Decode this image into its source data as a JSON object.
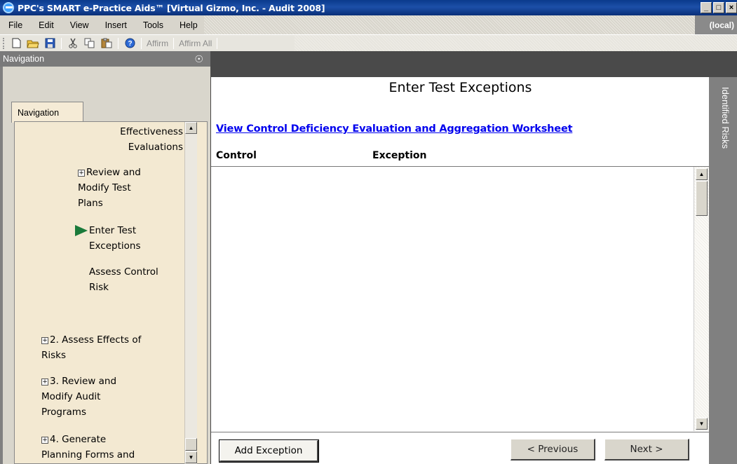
{
  "window": {
    "title": "PPC's SMART e-Practice Aids™ [Virtual Gizmo, Inc. - Audit 2008]",
    "buttons": [
      "_",
      "□",
      "×"
    ]
  },
  "menu": {
    "items": [
      "File",
      "Edit",
      "View",
      "Insert",
      "Tools",
      "Help"
    ],
    "right_label": "(local)"
  },
  "toolbar": {
    "icons": [
      "new-icon",
      "open-icon",
      "save-icon",
      "cut-icon",
      "copy-icon",
      "paste-icon",
      "help-icon"
    ],
    "affirm": "Affirm",
    "affirm_all": "Affirm All"
  },
  "navigation": {
    "header": "Navigation",
    "tab": "Navigation",
    "tree": [
      {
        "label": "Effectiveness\nEvaluations",
        "expander": false,
        "current": false
      },
      {
        "label": "Review and\nModify Test\nPlans",
        "expander": true,
        "current": false
      },
      {
        "label": "Enter Test\nExceptions",
        "expander": false,
        "current": true
      },
      {
        "label": "Assess Control\nRisk",
        "expander": false,
        "current": false
      },
      {
        "label": "2. Assess Effects of\nRisks",
        "expander": true,
        "current": false
      },
      {
        "label": "3. Review and\nModify Audit\nPrograms",
        "expander": true,
        "current": false
      },
      {
        "label": "4. Generate\nPlanning Forms and",
        "expander": true,
        "current": false
      }
    ]
  },
  "main": {
    "title": "Enter Test Exceptions",
    "link": "View Control Deficiency Evaluation and Aggregation Worksheet",
    "columns": [
      "Control",
      "Exception"
    ],
    "buttons": {
      "add": "Add Exception",
      "previous": "< Previous",
      "next": "Next >"
    }
  },
  "side_panel": {
    "label": "Identified Risks"
  },
  "colors": {
    "titlebar": "#0a3a8c",
    "link": "#0000ee",
    "nav_bg": "#f3e9d2",
    "panel_gray": "#808080"
  }
}
